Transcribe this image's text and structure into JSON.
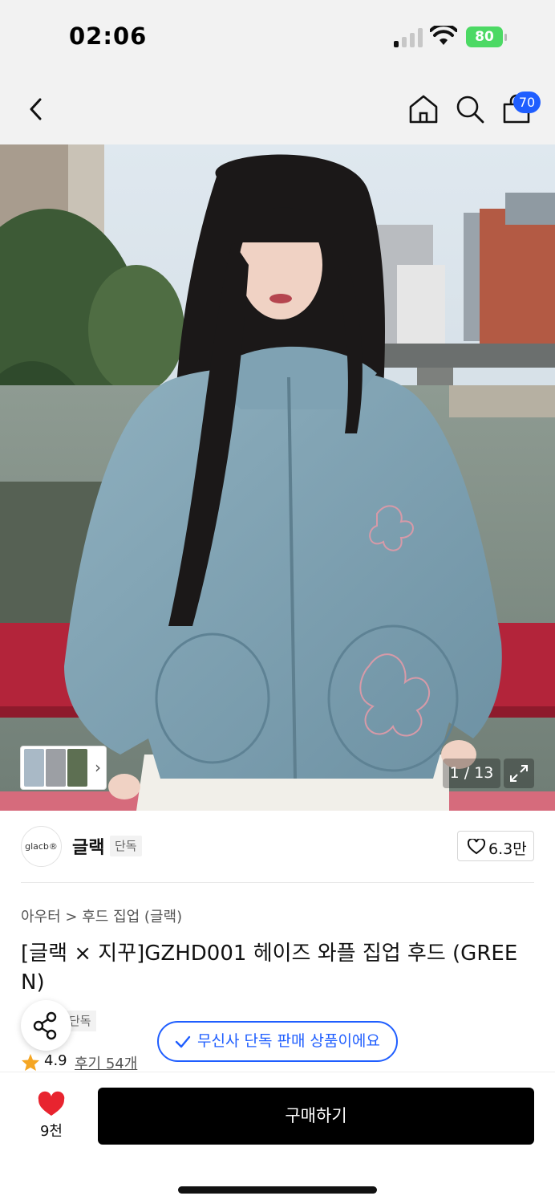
{
  "status_bar": {
    "time": "02:06",
    "battery": "80"
  },
  "nav": {
    "cart_count": "70"
  },
  "gallery": {
    "counter": "1 / 13"
  },
  "brand": {
    "logo_text": "glacb®",
    "name": "글랙",
    "tag": "단독",
    "like_count": "6.3만"
  },
  "product": {
    "breadcrumb": [
      "아우터",
      "후드 집업 (글랙)"
    ],
    "breadcrumb_separator": ">",
    "title": "[글랙 × 지꾸]GZHD001 헤이즈 와플 집업 후드 (GREEN)",
    "exclusive_tag": "단독",
    "rating": "4.9",
    "reviews": "후기 54개",
    "toast": "무신사 단독 판매 상품이에요"
  },
  "bottom": {
    "wish_count": "9천",
    "buy_label": "구매하기"
  },
  "colors": {
    "accent_blue": "#1f5eff",
    "battery_green": "#4cd964",
    "heart_red": "#e8242f",
    "star_orange": "#f5a623",
    "buy_black": "#000000"
  },
  "icons": [
    "back-icon",
    "home-icon",
    "search-icon",
    "cart-icon",
    "expand-icon",
    "heart-outline-icon",
    "share-icon",
    "check-icon",
    "star-icon",
    "heart-filled-icon"
  ]
}
